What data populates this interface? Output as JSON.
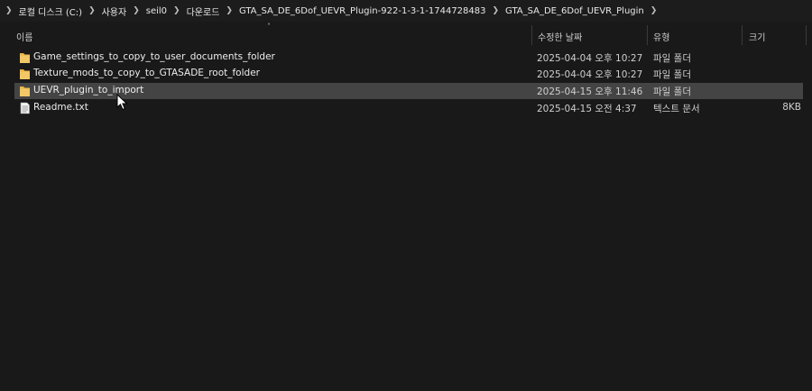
{
  "breadcrumb": {
    "items": [
      "로컬 디스크 (C:)",
      "사용자",
      "seil0",
      "다운로드",
      "GTA_SA_DE_6Dof_UEVR_Plugin-922-1-3-1-1744728483",
      "GTA_SA_DE_6Dof_UEVR_Plugin"
    ]
  },
  "columns": {
    "name": "이름",
    "date": "수정한 날짜",
    "type": "유형",
    "size": "크기"
  },
  "files": [
    {
      "name": "Game_settings_to_copy_to_user_documents_folder",
      "date": "2025-04-04 오후 10:27",
      "type": "파일 폴더",
      "size": "",
      "icon": "folder-icon",
      "selected": false
    },
    {
      "name": "Texture_mods_to_copy_to_GTASADE_root_folder",
      "date": "2025-04-04 오후 10:27",
      "type": "파일 폴더",
      "size": "",
      "icon": "folder-icon",
      "selected": false
    },
    {
      "name": "UEVR_plugin_to_import",
      "date": "2025-04-15 오후 11:46",
      "type": "파일 폴더",
      "size": "",
      "icon": "folder-icon",
      "selected": true
    },
    {
      "name": "Readme.txt",
      "date": "2025-04-15 오전 4:37",
      "type": "텍스트 문서",
      "size": "8KB",
      "icon": "text-file-icon",
      "selected": false
    }
  ],
  "colors": {
    "background": "#191919",
    "selected_row": "#444444",
    "folder": "#e8b64c"
  }
}
